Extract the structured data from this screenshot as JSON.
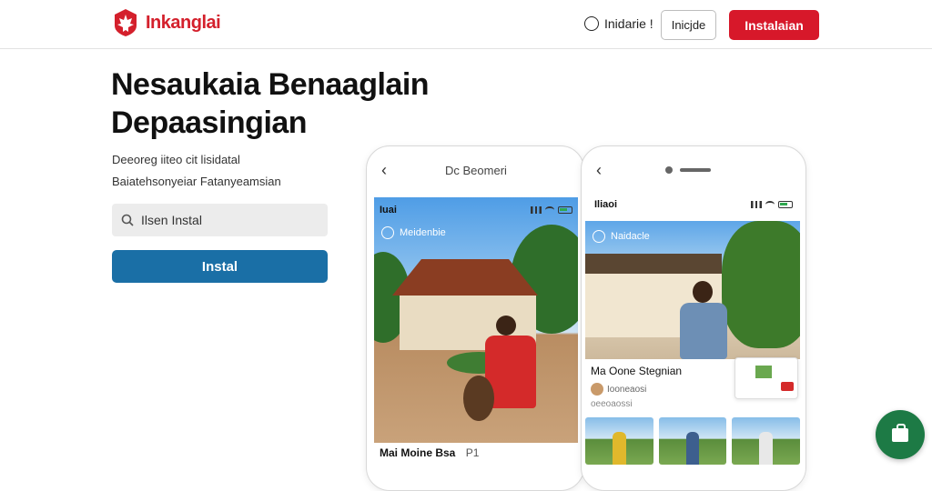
{
  "header": {
    "brand": "Inkanglai",
    "lang_label": "Inidarie !",
    "outline_button": "Inicjde",
    "install_button": "Instalaian",
    "brand_color": "#d4202c"
  },
  "hero": {
    "title": "Nesaukaia Benaaglain Depaasingian",
    "subtitle_line1": "Deeoreg iiteo cit lisidatal",
    "subtitle_line2": "Baiatehsonyeiar Fatanyeamsian",
    "search_placeholder": "Ilsen Instal",
    "cta_button": "Instal",
    "cta_color": "#1a6fa6"
  },
  "phone1": {
    "top_label": "Dc Beomeri",
    "status_label": "Iuai",
    "overlay_label": "Meidenbie",
    "caption": "Mai Moine Bsa",
    "caption_extra": "P1"
  },
  "phone2": {
    "status_label": "Iliaoi",
    "overlay_label": "Naidacle",
    "card_title": "Ma Oone Stegnian",
    "card_sub": "Iooneaosi",
    "card_date": "oeeoaossi"
  },
  "fab": {
    "icon": "shopping-bag-icon",
    "color": "#1d7a45"
  }
}
